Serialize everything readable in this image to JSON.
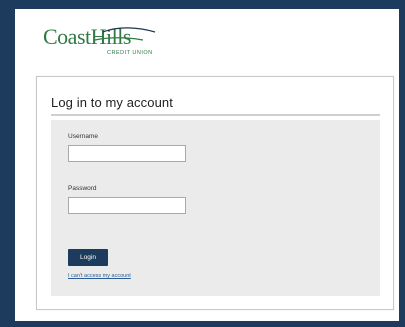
{
  "brand": {
    "logo_text": "CoastHills",
    "logo_subtitle": "CREDIT UNION",
    "color_primary": "#1d3b5c",
    "color_logo_green": "#2f7a44",
    "color_logo_navy": "#1f3550"
  },
  "login": {
    "title": "Log in to my account",
    "username_label": "Username",
    "username_value": "",
    "password_label": "Password",
    "password_value": "",
    "button_label": "Login",
    "help_link": "I can't access my account"
  }
}
